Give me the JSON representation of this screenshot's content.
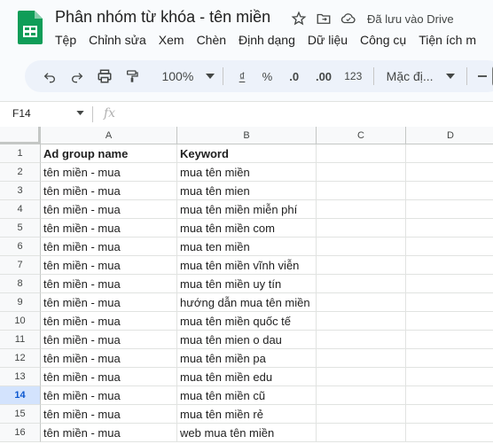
{
  "doc": {
    "title": "Phân nhóm từ khóa - tên miền",
    "saved_status": "Đã lưu vào Drive"
  },
  "menu": [
    "Tệp",
    "Chỉnh sửa",
    "Xem",
    "Chèn",
    "Định dạng",
    "Dữ liệu",
    "Công cụ",
    "Tiện ích m"
  ],
  "toolbar": {
    "zoom": "100%",
    "currency": "₫",
    "percent": "%",
    "decrease_decimal": ".0",
    "increase_decimal": ".00",
    "number_format": "123",
    "font": "Mặc đị..."
  },
  "formula_bar": {
    "cell_ref": "F14",
    "fx": "fx",
    "value": ""
  },
  "grid": {
    "columns": [
      "A",
      "B",
      "C",
      "D"
    ],
    "selected_row": 14,
    "rows": [
      {
        "n": "1",
        "a": "Ad group name",
        "b": "Keyword"
      },
      {
        "n": "2",
        "a": "tên miền - mua",
        "b": "mua tên miền"
      },
      {
        "n": "3",
        "a": "tên miền - mua",
        "b": "mua tên mien"
      },
      {
        "n": "4",
        "a": "tên miền - mua",
        "b": "mua tên miền miễn phí"
      },
      {
        "n": "5",
        "a": "tên miền - mua",
        "b": "mua tên miền com"
      },
      {
        "n": "6",
        "a": "tên miền - mua",
        "b": "mua ten miền"
      },
      {
        "n": "7",
        "a": "tên miền - mua",
        "b": "mua tên miền vĩnh viễn"
      },
      {
        "n": "8",
        "a": "tên miền - mua",
        "b": "mua tên miền uy tín"
      },
      {
        "n": "9",
        "a": "tên miền - mua",
        "b": "hướng dẫn mua tên miền"
      },
      {
        "n": "10",
        "a": "tên miền - mua",
        "b": "mua tên miền quốc tế"
      },
      {
        "n": "11",
        "a": "tên miền - mua",
        "b": "mua tên mien o dau"
      },
      {
        "n": "12",
        "a": "tên miền - mua",
        "b": "mua tên miền pa"
      },
      {
        "n": "13",
        "a": "tên miền - mua",
        "b": "mua tên miền edu"
      },
      {
        "n": "14",
        "a": "tên miền - mua",
        "b": "mua tên miền cũ"
      },
      {
        "n": "15",
        "a": "tên miền - mua",
        "b": "mua tên miền rẻ"
      },
      {
        "n": "16",
        "a": "tên miền - mua",
        "b": "web mua tên miền"
      }
    ]
  },
  "colors": {
    "sheets_green": "#0f9d58",
    "selection_blue": "#d3e3fd",
    "header_bg": "#f8f9fa"
  }
}
